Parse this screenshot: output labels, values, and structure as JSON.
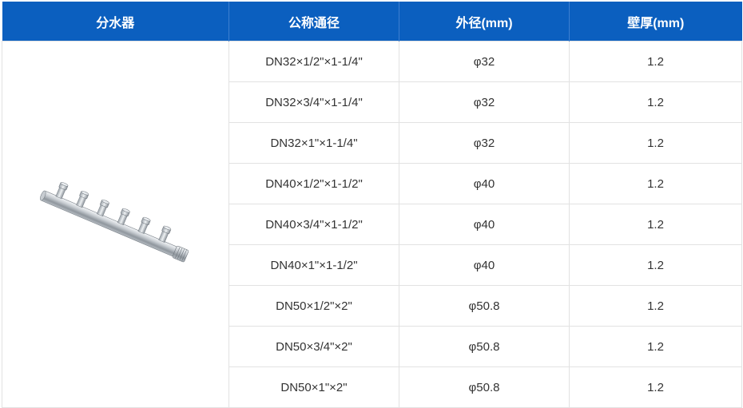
{
  "headers": {
    "col1": "分水器",
    "col2": "公称通径",
    "col3": "外径(mm)",
    "col4": "壁厚(mm)"
  },
  "rows": [
    {
      "nominal": "DN32×1/2\"×1-1/4\"",
      "od": "φ32",
      "wall": "1.2"
    },
    {
      "nominal": "DN32×3/4\"×1-1/4\"",
      "od": "φ32",
      "wall": "1.2"
    },
    {
      "nominal": "DN32×1\"×1-1/4\"",
      "od": "φ32",
      "wall": "1.2"
    },
    {
      "nominal": "DN40×1/2\"×1-1/2\"",
      "od": "φ40",
      "wall": "1.2"
    },
    {
      "nominal": "DN40×3/4\"×1-1/2\"",
      "od": "φ40",
      "wall": "1.2"
    },
    {
      "nominal": "DN40×1\"×1-1/2\"",
      "od": "φ40",
      "wall": "1.2"
    },
    {
      "nominal": "DN50×1/2\"×2\"",
      "od": "φ50.8",
      "wall": "1.2"
    },
    {
      "nominal": "DN50×3/4\"×2\"",
      "od": "φ50.8",
      "wall": "1.2"
    },
    {
      "nominal": "DN50×1\"×2\"",
      "od": "φ50.8",
      "wall": "1.2"
    }
  ],
  "colors": {
    "header_bg": "#0b5fbf",
    "header_text": "#ffffff",
    "border": "#e2e2e2",
    "cell_text": "#333333"
  },
  "image": {
    "icon": "stainless-steel-manifold-product-photo"
  }
}
